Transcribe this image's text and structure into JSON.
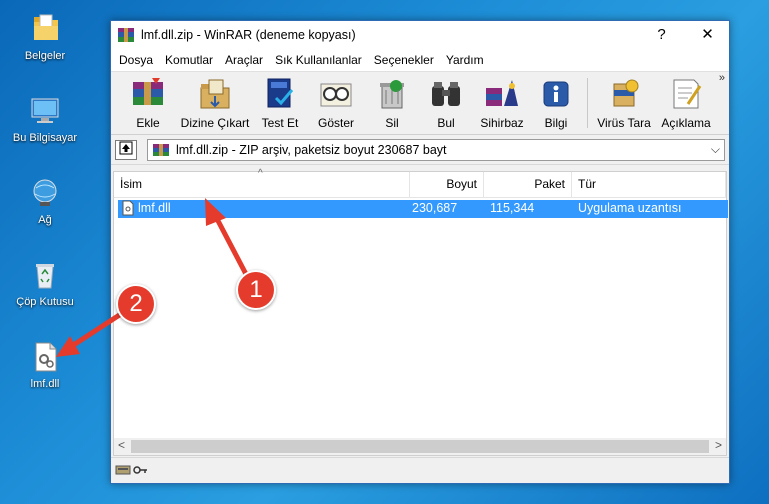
{
  "desktop": {
    "icons": [
      {
        "label": "Belgeler",
        "icon": "folder-icon"
      },
      {
        "label": "Bu Bilgisayar",
        "icon": "computer-icon"
      },
      {
        "label": "Ağ",
        "icon": "network-icon"
      },
      {
        "label": "Çöp Kutusu",
        "icon": "recycle-bin-icon"
      },
      {
        "label": "lmf.dll",
        "icon": "dll-file-icon"
      }
    ]
  },
  "window": {
    "title": "lmf.dll.zip - WinRAR (deneme kopyası)",
    "help_btn": "?",
    "close_btn": "✕"
  },
  "menu": [
    "Dosya",
    "Komutlar",
    "Araçlar",
    "Sık Kullanılanlar",
    "Seçenekler",
    "Yardım"
  ],
  "toolbar": [
    {
      "label": "Ekle",
      "icon": "add-archive-icon"
    },
    {
      "label": "Dizine Çıkart",
      "icon": "extract-to-icon"
    },
    {
      "label": "Test Et",
      "icon": "test-icon"
    },
    {
      "label": "Göster",
      "icon": "view-icon"
    },
    {
      "label": "Sil",
      "icon": "delete-icon"
    },
    {
      "label": "Bul",
      "icon": "find-icon"
    },
    {
      "label": "Sihirbaz",
      "icon": "wizard-icon"
    },
    {
      "label": "Bilgi",
      "icon": "info-icon"
    },
    {
      "label": "Virüs Tara",
      "icon": "virus-scan-icon"
    },
    {
      "label": "Açıklama",
      "icon": "comment-icon"
    }
  ],
  "toolbar_more": "»",
  "address": {
    "text": "lmf.dll.zip - ZIP arşiv, paketsiz boyut 230687 bayt",
    "dropdown": "⌵"
  },
  "columns": {
    "name": "İsim",
    "size": "Boyut",
    "packed": "Paket",
    "type": "Tür"
  },
  "files": [
    {
      "name": "lmf.dll",
      "size": "230,687",
      "packed": "115,344",
      "type": "Uygulama uzantısı"
    }
  ],
  "scroll": {
    "left": "<",
    "right": ">"
  },
  "callouts": [
    "1",
    "2"
  ],
  "colors": {
    "selection": "#3399ff",
    "callout": "#e53b2c",
    "desktop": "#1e8fd8"
  }
}
